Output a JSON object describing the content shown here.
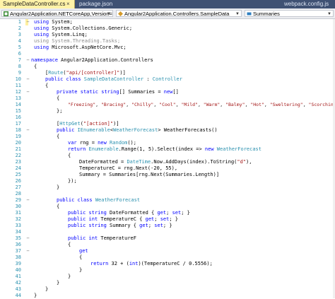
{
  "tabs": {
    "active": "SampleDataController.cs",
    "active_close": "×",
    "second": "package.json",
    "third": "webpack.config.js"
  },
  "navbar": {
    "project": "Angular2Application.NETCoreApp,Version=",
    "class": "Angular2Application.Controllers.SampleData",
    "member": "Summaries",
    "dropdown": "▼"
  },
  "line_numbers": [
    "1",
    "2",
    "3",
    "4",
    "5",
    "6",
    "7",
    "8",
    "9",
    "10",
    "11",
    "12",
    "13",
    "14",
    "15",
    "16",
    "17",
    "18",
    "19",
    "20",
    "21",
    "22",
    "23",
    "24",
    "25",
    "26",
    "27",
    "28",
    "29",
    "30",
    "31",
    "32",
    "33",
    "34",
    "35",
    "36",
    "37",
    "38",
    "39",
    "40",
    "41",
    "42",
    "43",
    "44"
  ],
  "outline_glyphs": {
    "collapse": "−"
  },
  "code_tokens": {
    "using": "using",
    "system": " System;",
    "system_collections": " System.Collections.Generic;",
    "system_linq": " System.Linq;",
    "system_threading": " System.Threading.Tasks;",
    "aspnet_mvc": " Microsoft.AspNetCore.Mvc;",
    "namespace": "namespace",
    "namespace_name": " Angular2Application.Controllers",
    "open_brace": "{",
    "close_brace": "}",
    "route_pre": "[",
    "route_kw": "Route",
    "route_str": "\"api/[controller]\"",
    "route_post": ")]",
    "route_paren": "(",
    "public": "public",
    "class": "class",
    "controller_name": " SampleDataController",
    "colon": " : ",
    "controller_base": "Controller",
    "private": "private",
    "static": "static",
    "string": "string",
    "summaries_decl": "[] Summaries = ",
    "new": "new",
    "new_arr": "[]",
    "s_freezing": "\"Freezing\"",
    "s_bracing": "\"Bracing\"",
    "s_chilly": "\"Chilly\"",
    "s_cool": "\"Cool\"",
    "s_mild": "\"Mild\"",
    "s_warm": "\"Warm\"",
    "s_balmy": "\"Balmy\"",
    "s_hot": "\"Hot\"",
    "s_sweltering": "\"Sweltering\"",
    "s_scorching": "\"Scorching\"",
    "comma": ", ",
    "semiclose": "};",
    "httpget": "HttpGet",
    "action_str": "\"[action]\"",
    "ienumerable": "IEnumerable",
    "lt": "<",
    "weather_forecast": "WeatherForecast",
    "gt_method": "> WeatherForecasts()",
    "var": "var",
    "rng_decl": " rng = ",
    "random": "Random",
    "paren_semicolon": "();",
    "return": "return",
    "enumerable": "Enumerable",
    "range_select": ".Range(1, 5).Select(index => ",
    "df_line_a": "DateFormatted = ",
    "datetime": "DateTime",
    "df_line_b": ".Now.AddDays(index).ToString(",
    "d_str": "\"d\"",
    "df_line_c": "),",
    "tc_line": "TemperatureC = rng.Next(-20, 55),",
    "summary_line": "Summary = Summaries[rng.Next(Summaries.Length)]",
    "close_select": "});",
    "public_class_wf": "WeatherForecast",
    "dateformatted_prop": " DateFormatted { ",
    "get": "get",
    "set": "set",
    "semi_space": "; ",
    "prop_close": "; }",
    "int": "int",
    "temperaturec_prop": " TemperatureC { ",
    "summary_prop": " Summary { ",
    "temperaturef_decl": " TemperatureF",
    "return_line": " 32 + (",
    "int_cast": "int",
    "tf_expr": ")(TemperatureC / 0.5556);"
  }
}
